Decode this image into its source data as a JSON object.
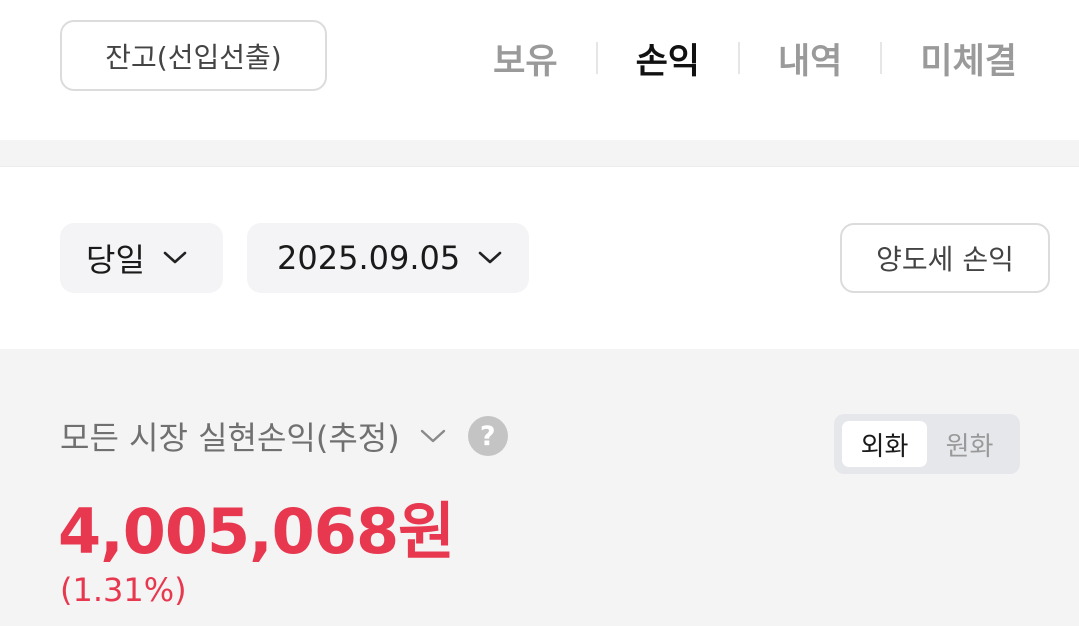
{
  "header": {
    "balance_button": "잔고(선입선출)",
    "tabs": [
      {
        "label": "보유",
        "active": false
      },
      {
        "label": "손익",
        "active": true
      },
      {
        "label": "내역",
        "active": false
      },
      {
        "label": "미체결",
        "active": false
      }
    ]
  },
  "filters": {
    "period": "당일",
    "date": "2025.09.05",
    "tax_button": "양도세 손익"
  },
  "summary": {
    "title": "모든 시장 실현손익(추정)",
    "help_glyph": "?",
    "currency_options": [
      {
        "label": "외화",
        "active": true
      },
      {
        "label": "원화",
        "active": false
      }
    ],
    "amount": "4,005,068원",
    "rate": "(1.31%)",
    "accent_color": "#e8384f"
  }
}
